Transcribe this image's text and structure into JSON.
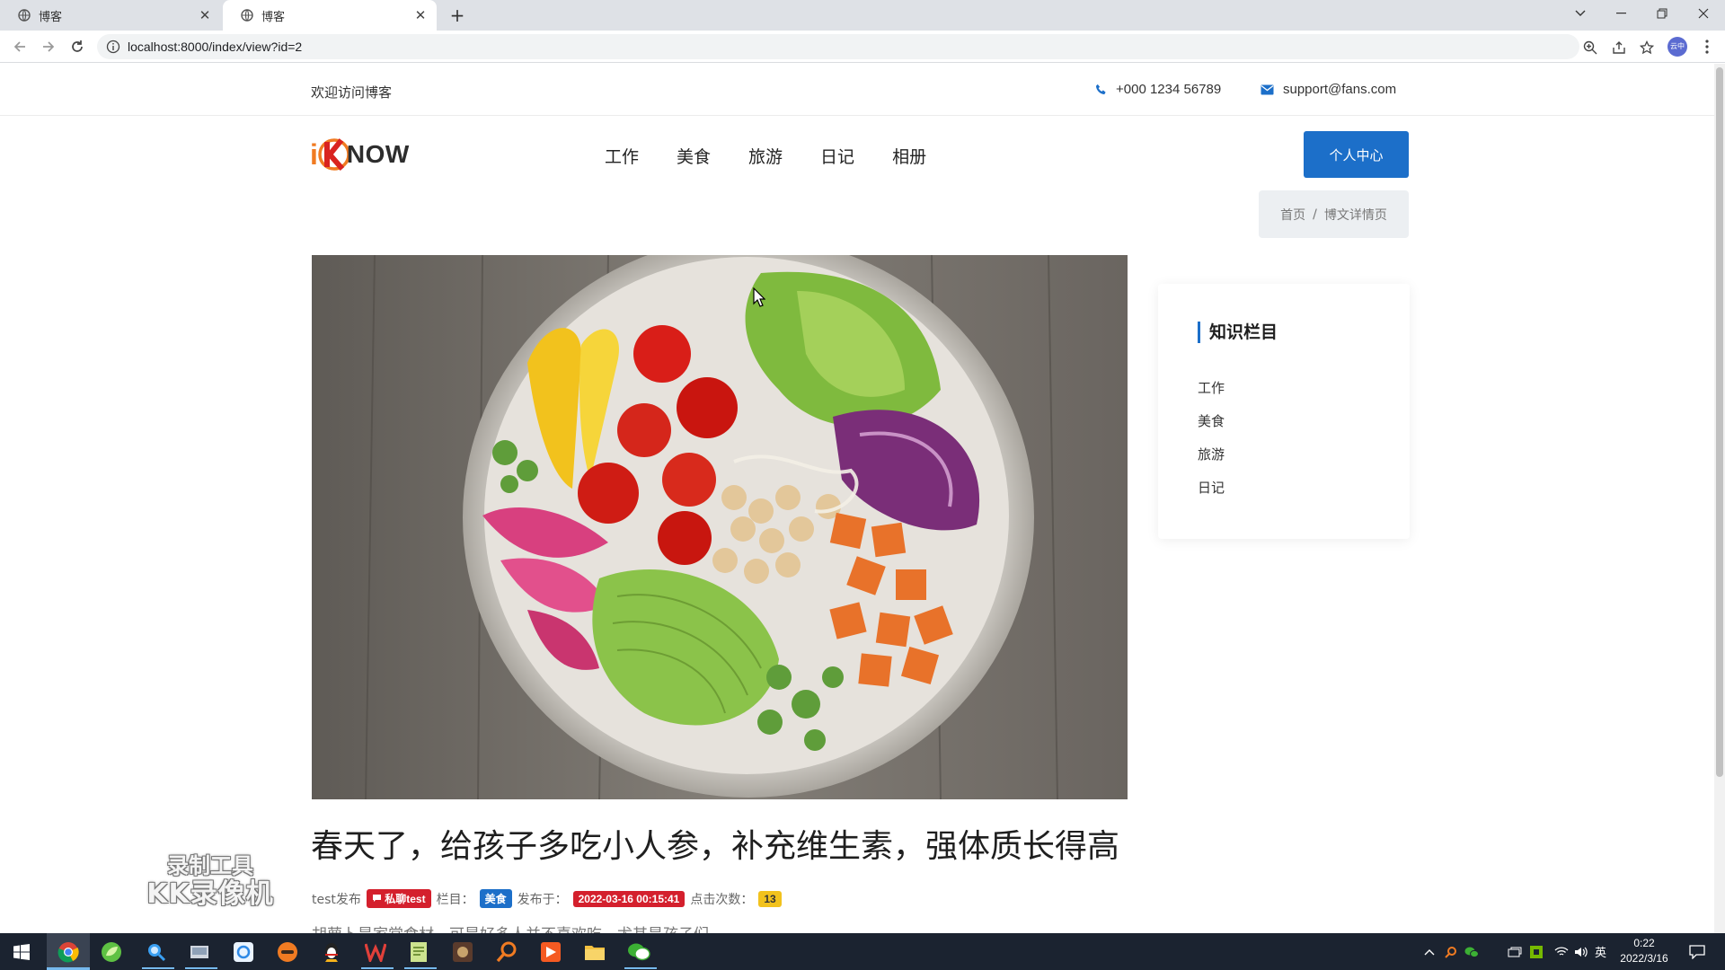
{
  "browser": {
    "tabs": [
      {
        "title": "博客"
      },
      {
        "title": "博客"
      }
    ],
    "url": "localhost:8000/index/view?id=2",
    "profile_label": "云中"
  },
  "topbar": {
    "welcome": "欢迎访问博客",
    "phone": "+000 1234 56789",
    "email": "support@fans.com"
  },
  "logo": {
    "i": "i",
    "now": "NOW"
  },
  "nav": {
    "items": [
      "工作",
      "美食",
      "旅游",
      "日记",
      "相册"
    ],
    "personal_center": "个人中心"
  },
  "breadcrumb": {
    "home": "首页",
    "separator": "/",
    "current": "博文详情页"
  },
  "article": {
    "title": "春天了，给孩子多吃小人参，补充维生素，强体质长得高",
    "author_text": "test发布",
    "tag_badge": "私聊test",
    "column_label": "栏目：",
    "column_value": "美食",
    "published_label": "发布于：",
    "published_value": "2022-03-16 00:15:41",
    "views_label": "点击次数：",
    "views_value": "13",
    "excerpt": "胡萝卜是家常食材，可是好多人并不喜欢吃，尤其是孩子们"
  },
  "sidebar": {
    "title": "知识栏目",
    "items": [
      "工作",
      "美食",
      "旅游",
      "日记"
    ]
  },
  "watermark": {
    "line1": "录制工具",
    "line2": "KK录像机"
  },
  "taskbar": {
    "ime": "英",
    "time": "0:22",
    "date": "2022/3/16"
  },
  "colors": {
    "primary": "#1c6fc9",
    "accent_orange": "#f07b22",
    "badge_red": "#d4202d",
    "badge_yellow": "#f2c21d"
  }
}
